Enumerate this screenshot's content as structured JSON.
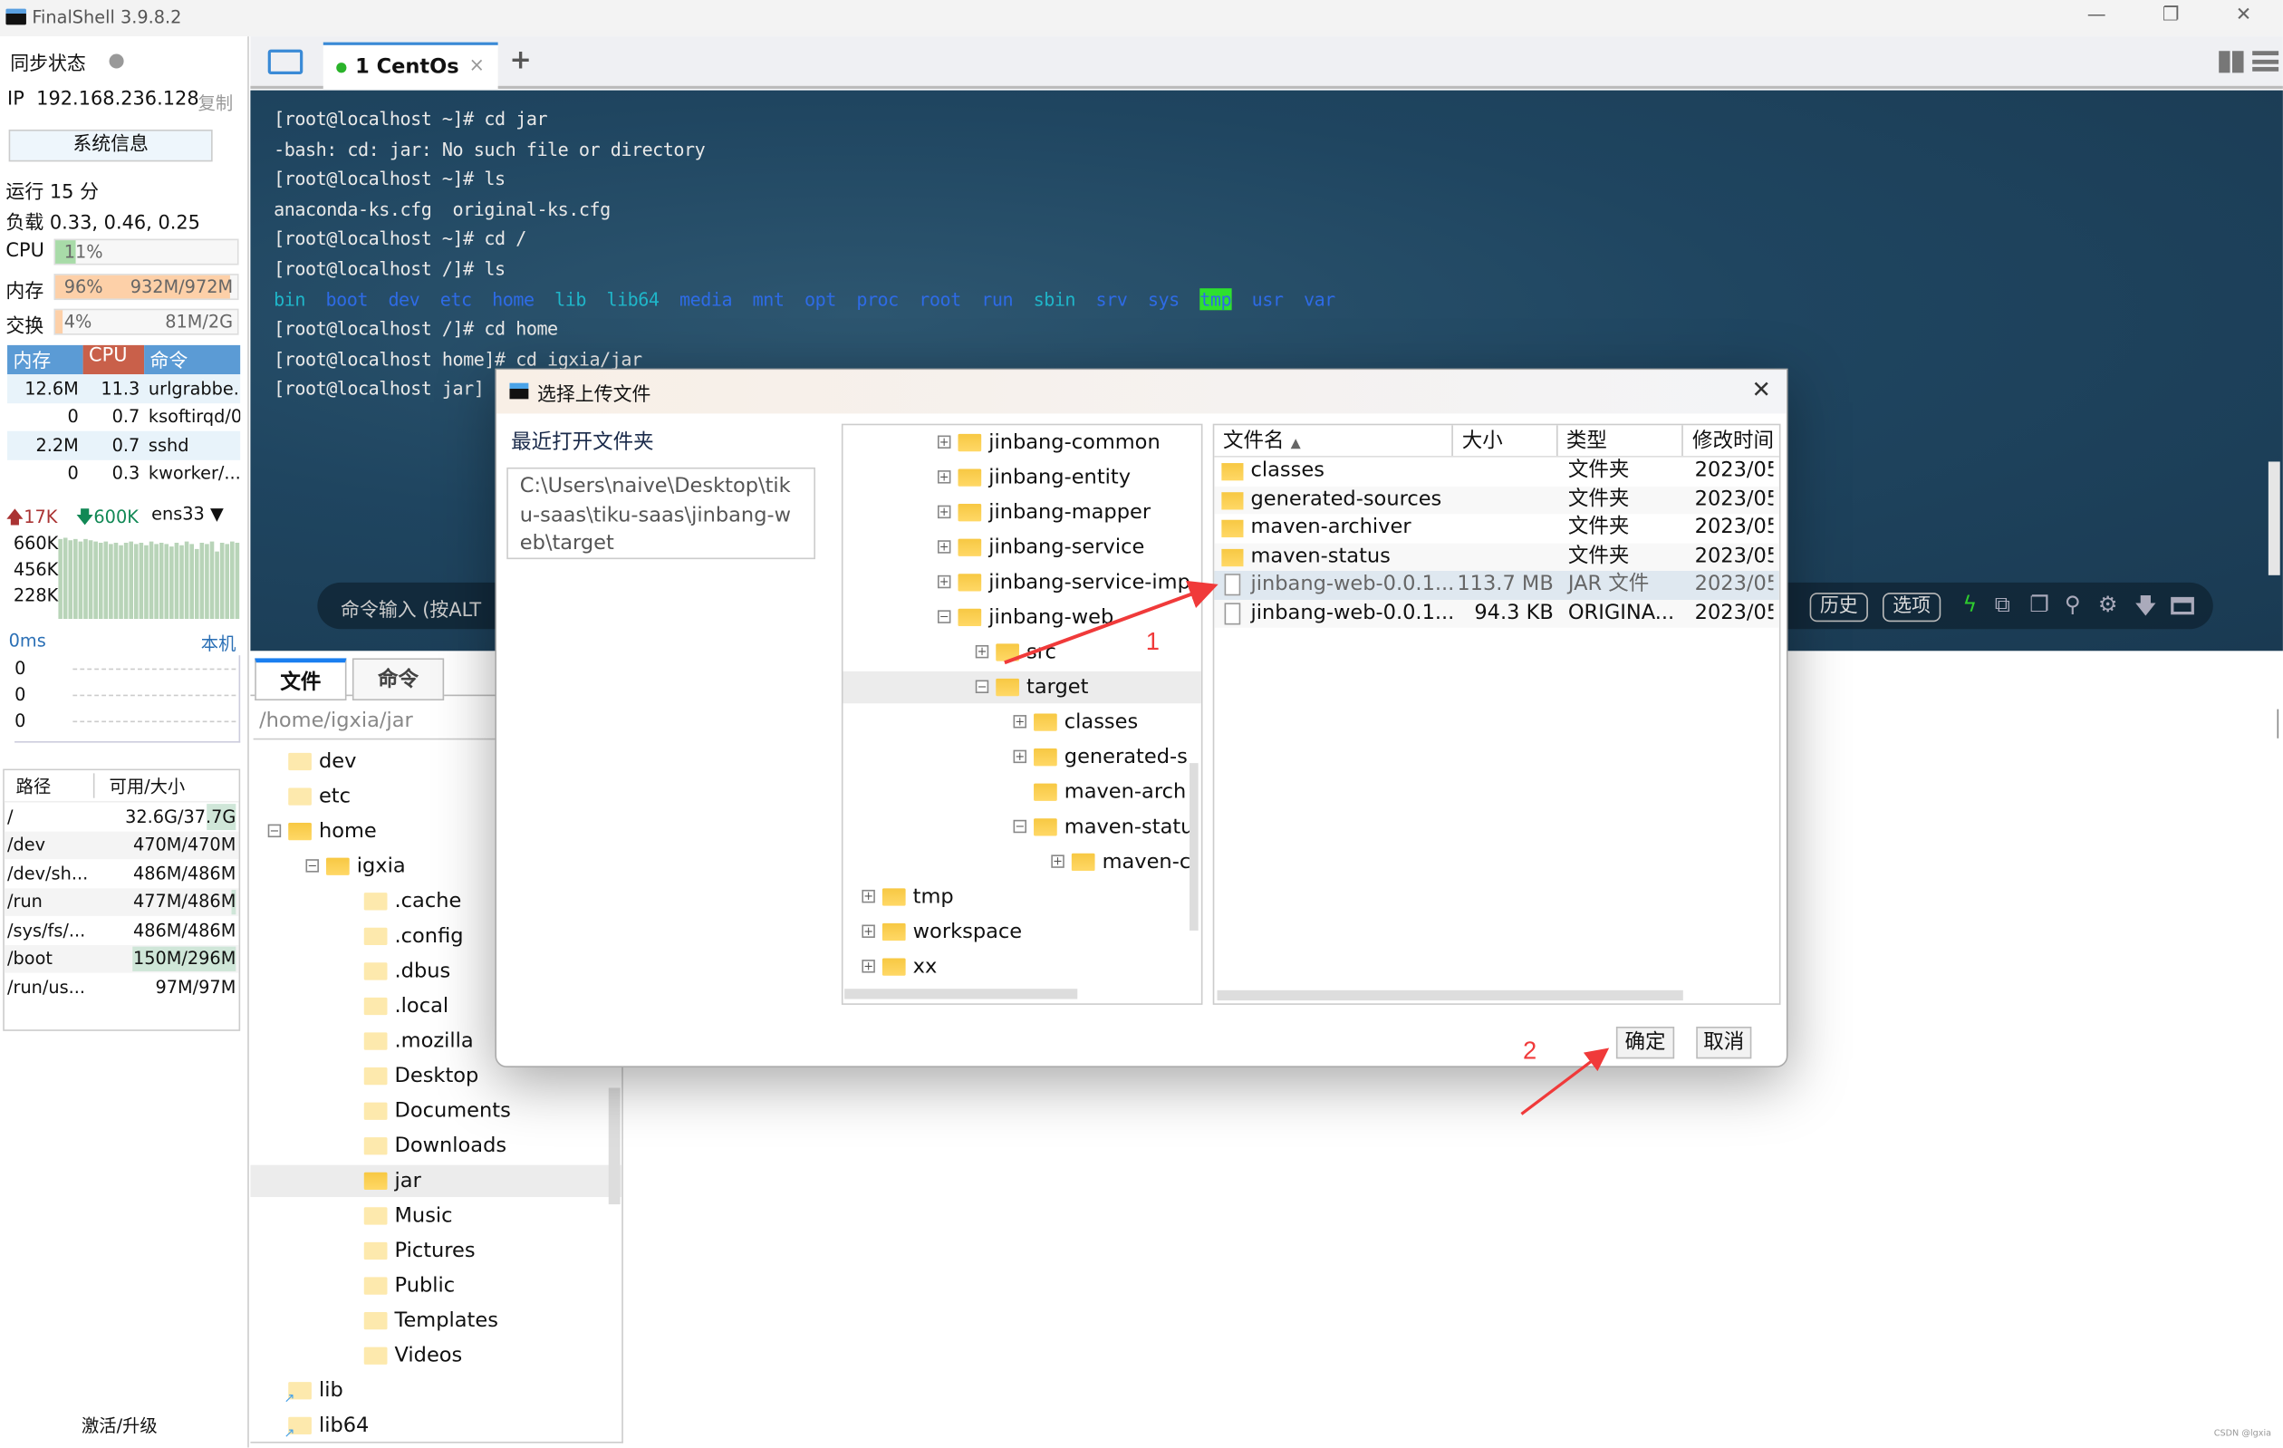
{
  "window": {
    "title": "FinalShell 3.9.8.2",
    "minimize": "—",
    "restore": "❐",
    "close": "✕"
  },
  "sidebar": {
    "sync_label": "同步状态",
    "ip_label": "IP",
    "ip": "192.168.236.128",
    "copy": "复制",
    "sysinfo_button": "系统信息",
    "uptime": "运行 15 分",
    "load": "负载 0.33, 0.46, 0.25",
    "cpu": {
      "label": "CPU",
      "text": "11%",
      "percent": 11
    },
    "mem": {
      "label": "内存",
      "text": "96%",
      "detail": "932M/972M",
      "percent": 96
    },
    "swap": {
      "label": "交换",
      "text": "4%",
      "detail": "81M/2G",
      "percent": 4
    },
    "proc_headers": [
      "内存",
      "CPU",
      "命令"
    ],
    "procs": [
      [
        "12.6M",
        "11.3",
        "urlgrabbe..."
      ],
      [
        "0",
        "0.7",
        "ksoftirqd/0"
      ],
      [
        "2.2M",
        "0.7",
        "sshd"
      ],
      [
        "0",
        "0.3",
        "kworker/..."
      ]
    ],
    "net": {
      "up": "17K",
      "down": "600K",
      "iface": "ens33",
      "ticks": [
        "660K",
        "456K",
        "228K"
      ],
      "history_k": [
        640,
        650,
        630,
        640,
        620,
        640,
        630,
        620,
        610,
        620,
        600,
        610,
        590,
        610,
        620,
        600,
        610,
        590,
        620,
        600,
        610,
        600,
        580,
        610,
        590,
        620,
        600,
        560,
        610,
        600,
        620,
        540,
        610,
        600,
        620,
        610
      ]
    },
    "ping": {
      "latency": "0ms",
      "host": "本机",
      "values": [
        "0",
        "0",
        "0"
      ]
    },
    "disk_headers": [
      "路径",
      "可用/大小"
    ],
    "disks": [
      [
        "/",
        "32.6G/37.7G",
        14
      ],
      [
        "/dev",
        "470M/470M",
        0
      ],
      [
        "/dev/sh...",
        "486M/486M",
        0
      ],
      [
        "/run",
        "477M/486M",
        2
      ],
      [
        "/sys/fs/...",
        "486M/486M",
        0
      ],
      [
        "/boot",
        "150M/296M",
        49
      ],
      [
        "/run/us...",
        "97M/97M",
        0
      ]
    ],
    "activate": "激活/升级"
  },
  "tabs": {
    "session": "1 CentOs",
    "add": "+"
  },
  "terminal": {
    "lines": [
      "[root@localhost ~]# cd jar",
      "-bash: cd: jar: No such file or directory",
      "[root@localhost ~]# ls",
      "anaconda-ks.cfg  original-ks.cfg",
      "[root@localhost ~]# cd /",
      "[root@localhost /]# ls",
      null,
      "[root@localhost /]# cd home",
      "[root@localhost home]# cd igxia/jar",
      "[root@localhost jar]"
    ],
    "ls_entries": [
      [
        "bin",
        "#1fb6c9"
      ],
      [
        "boot",
        "#2e6be6"
      ],
      [
        "dev",
        "#2e6be6"
      ],
      [
        "etc",
        "#2e6be6"
      ],
      [
        "home",
        "#2e6be6"
      ],
      [
        "lib",
        "#1fb6c9"
      ],
      [
        "lib64",
        "#1fb6c9"
      ],
      [
        "media",
        "#2e6be6"
      ],
      [
        "mnt",
        "#2e6be6"
      ],
      [
        "opt",
        "#2e6be6"
      ],
      [
        "proc",
        "#2e6be6"
      ],
      [
        "root",
        "#2e6be6"
      ],
      [
        "run",
        "#2e6be6"
      ],
      [
        "sbin",
        "#1fb6c9"
      ],
      [
        "srv",
        "#2e6be6"
      ],
      [
        "sys",
        "#2e6be6"
      ],
      [
        "tmp",
        "#2e6be6"
      ],
      [
        "usr",
        "#2e6be6"
      ],
      [
        "var",
        "#2e6be6"
      ]
    ],
    "cmd_placeholder": "命令输入 (按ALT",
    "history": "历史",
    "options": "选项"
  },
  "files": {
    "tab_files": "文件",
    "tab_commands": "命令",
    "path": "/home/igxia/jar",
    "tree": [
      [
        "dev",
        0,
        "none",
        "pale"
      ],
      [
        "etc",
        0,
        "none",
        "pale"
      ],
      [
        "home",
        0,
        "minus",
        "yellow"
      ],
      [
        "igxia",
        1,
        "minus",
        "yellow"
      ],
      [
        ".cache",
        2,
        "none",
        "pale"
      ],
      [
        ".config",
        2,
        "none",
        "pale"
      ],
      [
        ".dbus",
        2,
        "none",
        "pale"
      ],
      [
        ".local",
        2,
        "none",
        "pale"
      ],
      [
        ".mozilla",
        2,
        "none",
        "pale"
      ],
      [
        "Desktop",
        2,
        "none",
        "pale"
      ],
      [
        "Documents",
        2,
        "none",
        "pale"
      ],
      [
        "Downloads",
        2,
        "none",
        "pale"
      ],
      [
        "jar",
        2,
        "none",
        "yellow"
      ],
      [
        "Music",
        2,
        "none",
        "pale"
      ],
      [
        "Pictures",
        2,
        "none",
        "pale"
      ],
      [
        "Public",
        2,
        "none",
        "pale"
      ],
      [
        "Templates",
        2,
        "none",
        "pale"
      ],
      [
        "Videos",
        2,
        "none",
        "pale"
      ],
      [
        "lib",
        0,
        "link",
        "pale"
      ],
      [
        "lib64",
        0,
        "link",
        "pale"
      ]
    ],
    "selected": "jar"
  },
  "dialog": {
    "title": "选择上传文件",
    "recent_label": "最近打开文件夹",
    "recent_path": "C:\\Users\\naive\\Desktop\\tiku-saas\\tiku-saas\\jinbang-web\\target",
    "tree": [
      [
        "jinbang-common",
        2,
        "plus"
      ],
      [
        "jinbang-entity",
        2,
        "plus"
      ],
      [
        "jinbang-mapper",
        2,
        "plus"
      ],
      [
        "jinbang-service",
        2,
        "plus"
      ],
      [
        "jinbang-service-imp",
        2,
        "plus"
      ],
      [
        "jinbang-web",
        2,
        "minus"
      ],
      [
        "src",
        3,
        "plus"
      ],
      [
        "target",
        3,
        "minus"
      ],
      [
        "classes",
        4,
        "plus"
      ],
      [
        "generated-s",
        4,
        "plus"
      ],
      [
        "maven-arch",
        4,
        "none"
      ],
      [
        "maven-statu",
        4,
        "minus"
      ],
      [
        "maven-c",
        5,
        "plus"
      ],
      [
        "tmp",
        0,
        "plus"
      ],
      [
        "workspace",
        0,
        "plus"
      ],
      [
        "xx",
        0,
        "plus"
      ]
    ],
    "tree_selected": "target",
    "columns": [
      "文件名",
      "大小",
      "类型",
      "修改时间"
    ],
    "rows": [
      [
        "classes",
        "",
        "文件夹",
        "2023/05/",
        "folder"
      ],
      [
        "generated-sources",
        "",
        "文件夹",
        "2023/05/",
        "folder"
      ],
      [
        "maven-archiver",
        "",
        "文件夹",
        "2023/05/",
        "folder"
      ],
      [
        "maven-status",
        "",
        "文件夹",
        "2023/05/",
        "folder"
      ],
      [
        "jinbang-web-0.0.1...",
        "113.7 MB",
        "JAR 文件",
        "2023/05/",
        "file"
      ],
      [
        "jinbang-web-0.0.1...",
        "94.3 KB",
        "ORIGINA...",
        "2023/05/",
        "file"
      ]
    ],
    "selected_row": 4,
    "ok": "确定",
    "cancel": "取消"
  },
  "annotations": {
    "step1": "1",
    "step2": "2",
    "color": "#f03a3a"
  },
  "watermark": "CSDN @lgxia"
}
